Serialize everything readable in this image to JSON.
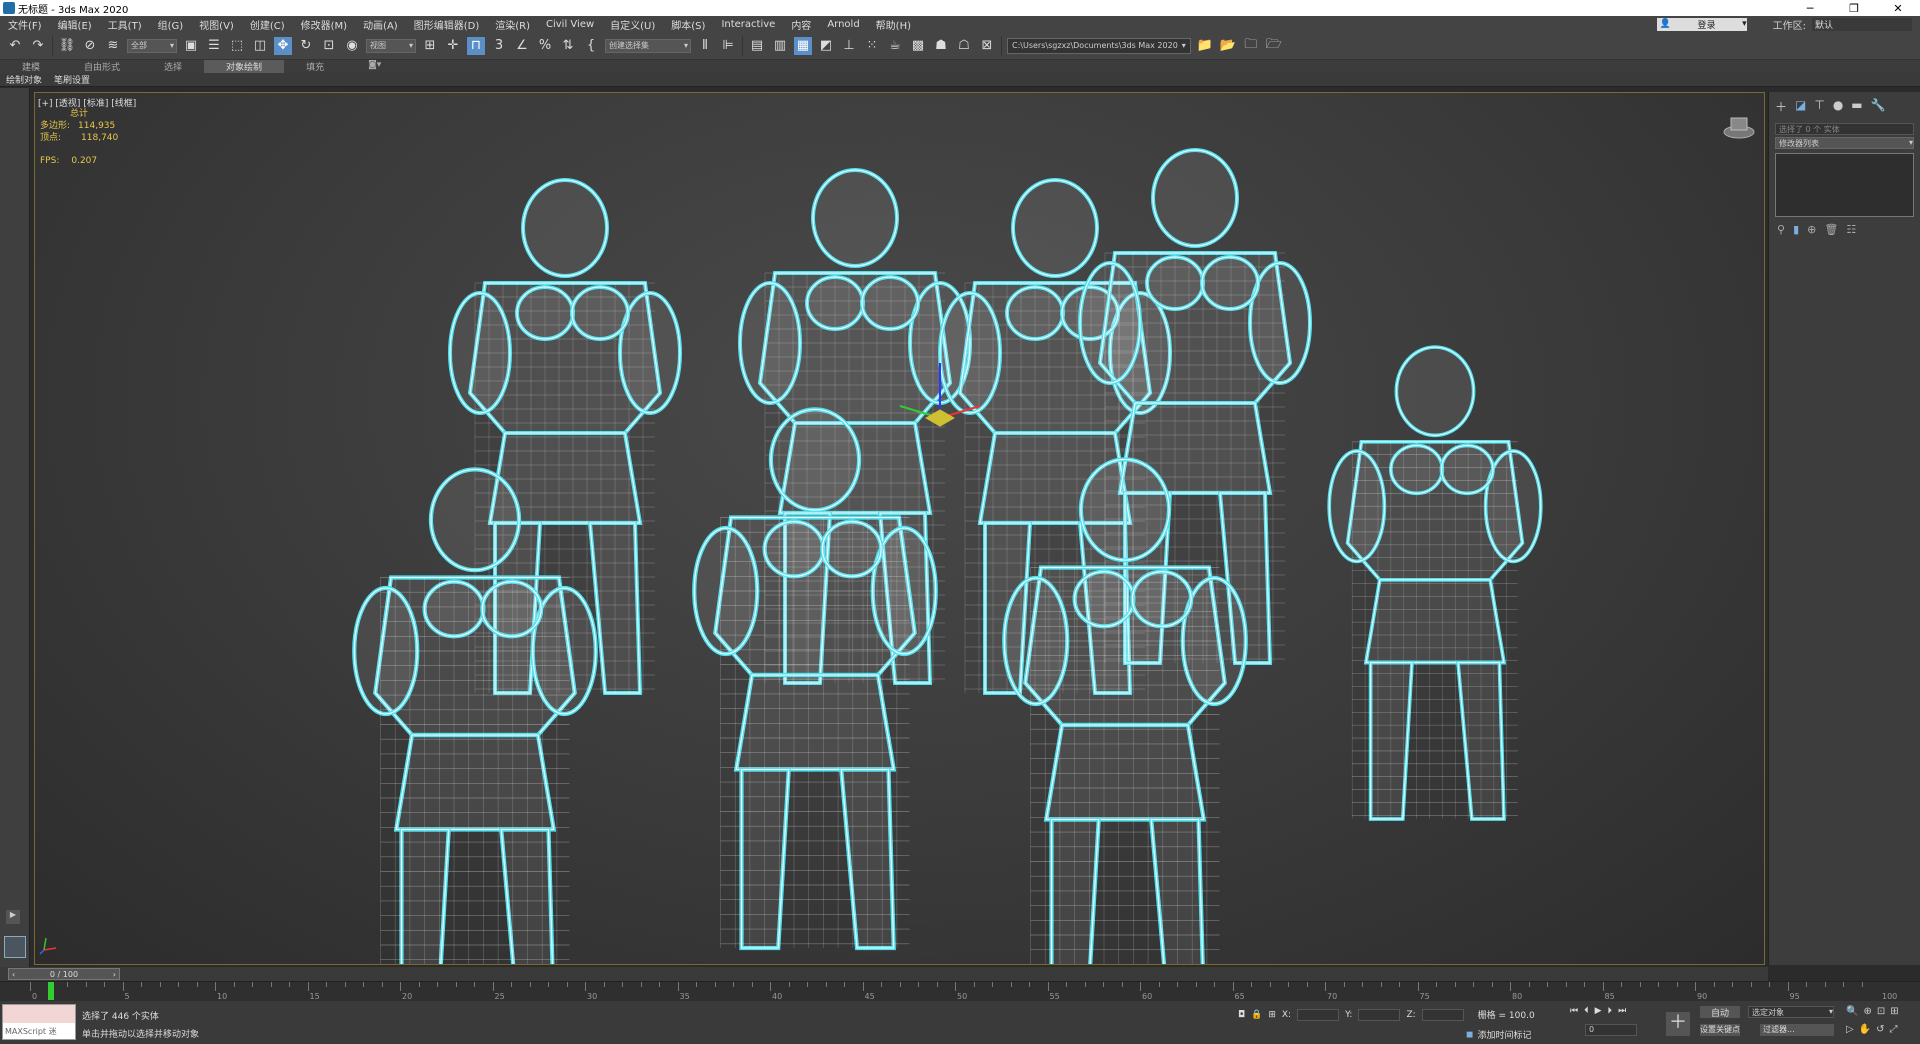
{
  "window": {
    "title": "无标题 - 3ds Max 2020",
    "buttons": [
      "─",
      "❐",
      "✕"
    ]
  },
  "menu": [
    "文件(F)",
    "编辑(E)",
    "工具(T)",
    "组(G)",
    "视图(V)",
    "创建(C)",
    "修改器(M)",
    "动画(A)",
    "图形编辑器(D)",
    "渲染(R)",
    "Civil View",
    "自定义(U)",
    "脚本(S)",
    "Interactive",
    "内容",
    "Arnold",
    "帮助(H)"
  ],
  "account": {
    "login": "登录",
    "workspace_label": "工作区:",
    "workspace_value": "默认"
  },
  "toolbar": {
    "filter": "全部",
    "refcoord": "视图",
    "selset": "创建选择集",
    "path": "C:\\Users\\sgzxz\\Documents\\3ds Max 2020"
  },
  "ribbon": [
    "建模",
    "自由形式",
    "选择",
    "对象绘制",
    "填充"
  ],
  "subbar": [
    "绘制对象",
    "笔刷设置"
  ],
  "viewport": {
    "label": "[+] [透视] [标准] [线框]",
    "stats_header": "总计",
    "polys_label": "多边形:",
    "polys_value": "114,935",
    "verts_label": "顶点:",
    "verts_value": "118,740",
    "fps_label": "FPS:",
    "fps_value": "0.207"
  },
  "command_panel": {
    "selection_name": "选择了 0 个 实体",
    "modifier_list": "修改器列表"
  },
  "time": {
    "slider": "0 / 100",
    "ticks": [
      "0",
      "5",
      "10",
      "15",
      "20",
      "25",
      "30",
      "35",
      "40",
      "45",
      "50",
      "55",
      "60",
      "65",
      "70",
      "75",
      "80",
      "85",
      "90",
      "95",
      "100"
    ]
  },
  "status": {
    "maxscript": "MAXScript 迷",
    "line1": "选择了 446 个实体",
    "line2": "单击并拖动以选择并移动对象",
    "x_label": "X:",
    "y_label": "Y:",
    "z_label": "Z:",
    "grid": "栅格 = 100.0",
    "auto": "自动",
    "selected_obj": "选定对象",
    "set_key": "设置关键点",
    "filter": "过滤器...",
    "add_time_tag": "添加时间标记",
    "frame": "0"
  },
  "colors": {
    "accent": "#5a8fc8",
    "wire": "#ffffff",
    "select_outline": "#4fe0ee",
    "stats": "#e5c84a"
  }
}
